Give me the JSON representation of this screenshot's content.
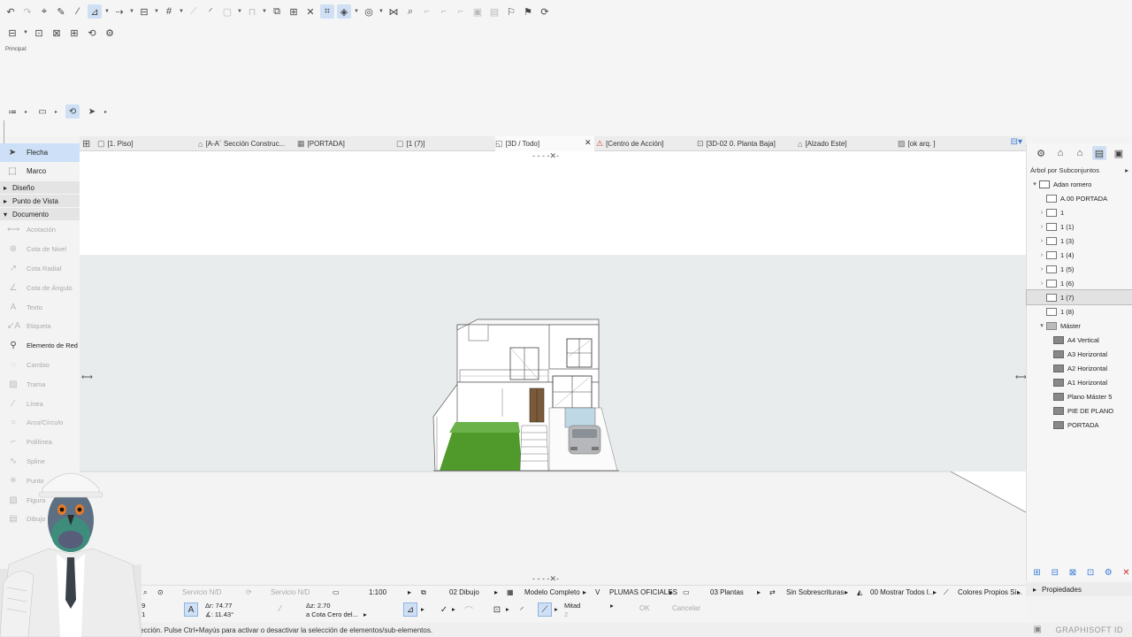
{
  "toolbar": {
    "icons": [
      "undo-icon",
      "redo-icon",
      "pick-up-icon",
      "inject-icon",
      "eyedropper-icon",
      "arrow-select-icon",
      "quick-options-icon",
      "align-icon",
      "grid-icon",
      "ruler-icon",
      "magic-wand-icon",
      "marquee-icon",
      "lock-icon",
      "trace-icon",
      "show-icon",
      "layer-icon",
      "renovation-icon",
      "view-icon",
      "surface-icon",
      "split-icon",
      "find-icon",
      "offset-icon",
      "flag-icon",
      "publish-icon",
      "refresh-icon"
    ]
  },
  "principal": {
    "label": "Principal:"
  },
  "tabs": {
    "items": [
      {
        "label": "[1. Piso]"
      },
      {
        "label": "[A-A´ Sección Construc..."
      },
      {
        "label": "[PORTADA]"
      },
      {
        "label": "[1 (7)]"
      },
      {
        "label": "[3D / Todo]"
      },
      {
        "label": "[Centro de Acción]"
      },
      {
        "label": "[3D-02 0. Planta Baja]"
      },
      {
        "label": "[Alzado Este]"
      },
      {
        "label": "[ok arq. ]"
      }
    ]
  },
  "left_panel": {
    "arrow": "Flecha",
    "marquee": "Marco",
    "sections": [
      "Diseño",
      "Punto de Vista",
      "Documento"
    ],
    "tools": [
      {
        "label": "Acotación",
        "enabled": false
      },
      {
        "label": "Cota de Nivel",
        "enabled": false
      },
      {
        "label": "Cota Radial",
        "enabled": false
      },
      {
        "label": "Cota de Ángulo",
        "enabled": false
      },
      {
        "label": "Texto",
        "enabled": false
      },
      {
        "label": "Etiqueta",
        "enabled": false
      },
      {
        "label": "Elemento de Red",
        "enabled": true
      },
      {
        "label": "Cambio",
        "enabled": false
      },
      {
        "label": "Trama",
        "enabled": false
      },
      {
        "label": "Línea",
        "enabled": false
      },
      {
        "label": "Arco/Círculo",
        "enabled": false
      },
      {
        "label": "Polilínea",
        "enabled": false
      },
      {
        "label": "Spline",
        "enabled": false
      },
      {
        "label": "Punto",
        "enabled": false
      },
      {
        "label": "Figura",
        "enabled": false
      },
      {
        "label": "Dibujo",
        "enabled": false
      }
    ]
  },
  "right_panel": {
    "dropdown": "Árbol por Subconjuntos",
    "tree": [
      {
        "label": "Adan romero",
        "arrow": "v",
        "indent": 0,
        "type": "book"
      },
      {
        "label": "A.00 PORTADA",
        "arrow": "",
        "indent": 1,
        "type": "page"
      },
      {
        "label": "1",
        "arrow": ">",
        "indent": 1,
        "type": "page"
      },
      {
        "label": "1 (1)",
        "arrow": ">",
        "indent": 1,
        "type": "page"
      },
      {
        "label": "1 (3)",
        "arrow": ">",
        "indent": 1,
        "type": "page"
      },
      {
        "label": "1 (4)",
        "arrow": ">",
        "indent": 1,
        "type": "page"
      },
      {
        "label": "1 (5)",
        "arrow": ">",
        "indent": 1,
        "type": "page"
      },
      {
        "label": "1 (6)",
        "arrow": ">",
        "indent": 1,
        "type": "page"
      },
      {
        "label": "1 (7)",
        "arrow": "",
        "indent": 1,
        "type": "page",
        "selected": true
      },
      {
        "label": "1 (8)",
        "arrow": "",
        "indent": 1,
        "type": "page"
      },
      {
        "label": "Máster",
        "arrow": "v",
        "indent": 1,
        "type": "folder"
      },
      {
        "label": "A4 Vertical",
        "arrow": "",
        "indent": 2,
        "type": "master"
      },
      {
        "label": "A3 Horizontal",
        "arrow": "",
        "indent": 2,
        "type": "master"
      },
      {
        "label": "A2 Horizontal",
        "arrow": "",
        "indent": 2,
        "type": "master"
      },
      {
        "label": "A1 Horizontal",
        "arrow": "",
        "indent": 2,
        "type": "master"
      },
      {
        "label": "Plano Máster 5",
        "arrow": "",
        "indent": 2,
        "type": "master"
      },
      {
        "label": "PIE DE PLANO",
        "arrow": "",
        "indent": 2,
        "type": "master"
      },
      {
        "label": "PORTADA",
        "arrow": "",
        "indent": 2,
        "type": "master"
      }
    ],
    "properties": "Propiedades"
  },
  "viewbar": {
    "service1": "Servicio N/D",
    "service2": "Servicio N/D",
    "scale": "1:100",
    "layer_combo": "02 Dibujo",
    "model_view": "Modelo Completo",
    "pen_set": "PLUMAS OFICIALES",
    "floors": "03 Plantas",
    "overrides": "Sin Sobrescrituras",
    "renovation": "00 Mostrar Todos l...",
    "colors": "Colores Propios Si..."
  },
  "infobox": {
    "num1": "29",
    "num2": "31",
    "dr": "Δr: 74.77",
    "da": "∡: 11.43°",
    "dz": "Δz: 2.70",
    "ref": "a Cota Cero del...",
    "snap": "Mitad",
    "snap_num": "2",
    "ok": "OK",
    "cancel": "Cancelar"
  },
  "status": {
    "text": "ección. Pulse Ctrl+Mayús para activar o desactivar la selección de elementos/sub-elementos.",
    "brand": "GRAPHISOFT ID"
  },
  "colors": {
    "selection": "#cde0f7",
    "accent": "#3a7bd5",
    "grass": "#4f9a2a"
  }
}
